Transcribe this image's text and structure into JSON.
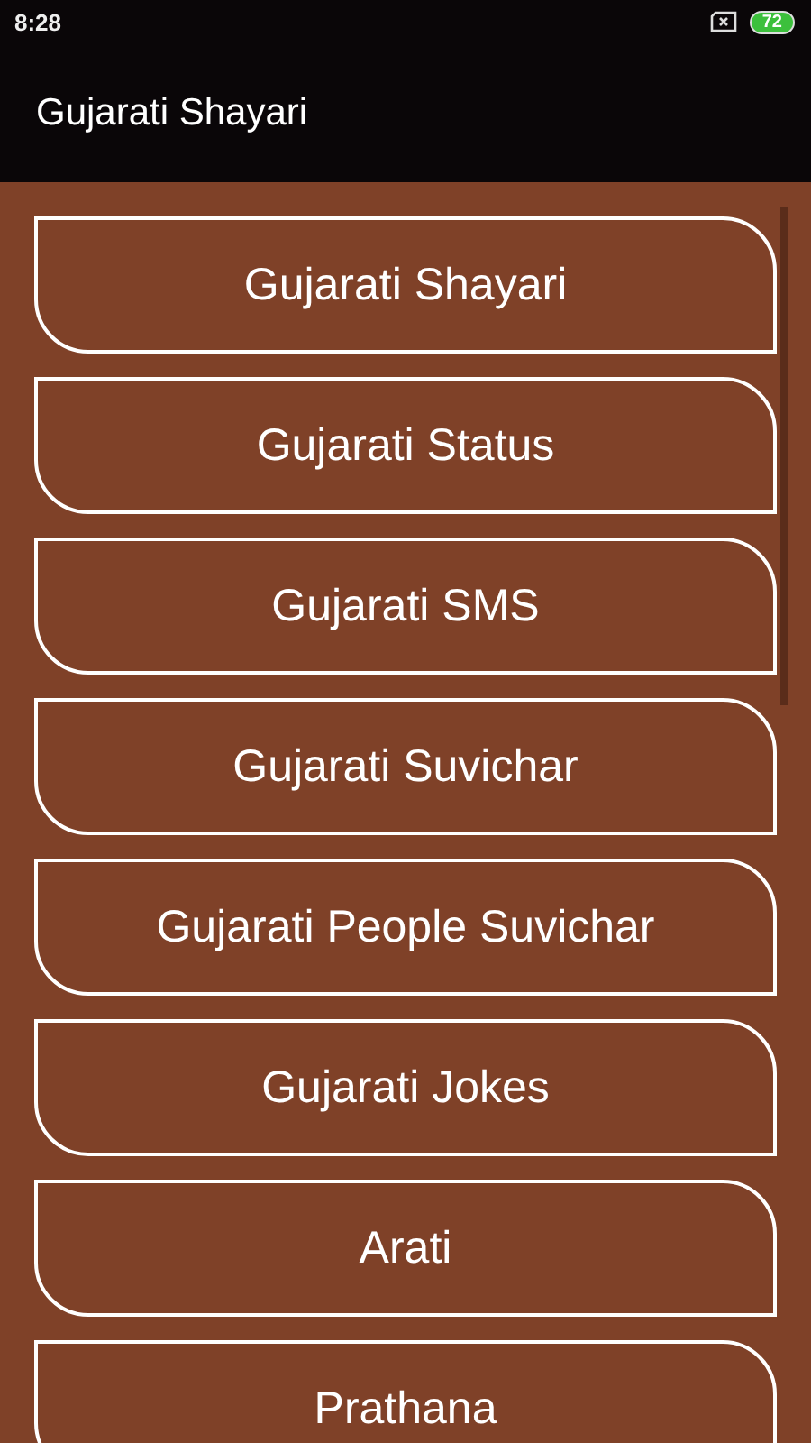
{
  "status_bar": {
    "time": "8:28",
    "battery": "72"
  },
  "app_bar": {
    "title": "Gujarati Shayari"
  },
  "menu": [
    {
      "label": "Gujarati Shayari"
    },
    {
      "label": "Gujarati Status"
    },
    {
      "label": "Gujarati SMS"
    },
    {
      "label": "Gujarati Suvichar"
    },
    {
      "label": "Gujarati People Suvichar"
    },
    {
      "label": "Gujarati Jokes"
    },
    {
      "label": "Arati"
    },
    {
      "label": "Prathana"
    }
  ]
}
